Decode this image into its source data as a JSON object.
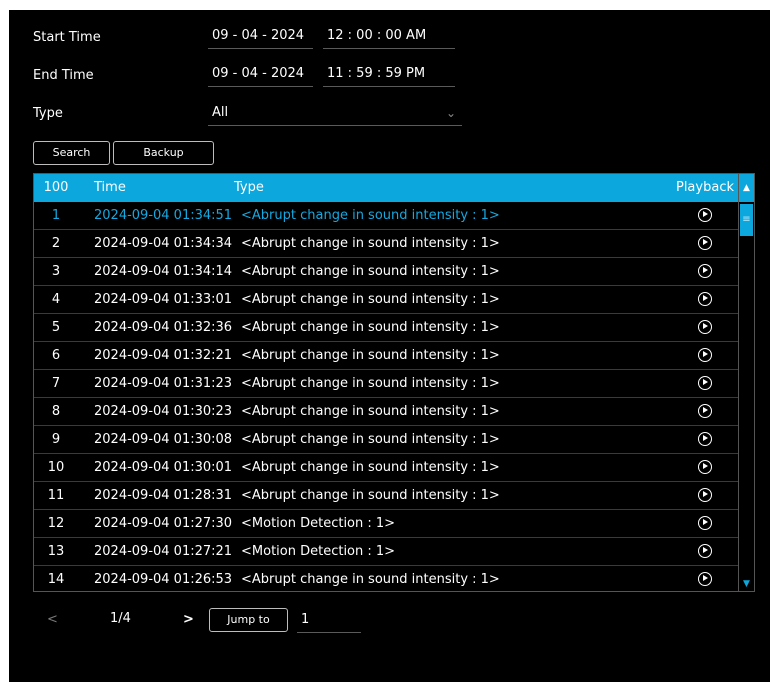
{
  "filters": {
    "start_label": "Start Time",
    "start_date": "09 - 04 - 2024",
    "start_time": "12 : 00 : 00  AM",
    "end_label": "End Time",
    "end_date": "09 - 04 - 2024",
    "end_time": "11 : 59 : 59  PM",
    "type_label": "Type",
    "type_value": "All"
  },
  "buttons": {
    "search": "Search",
    "backup": "Backup",
    "jump": "Jump to"
  },
  "table": {
    "headers": {
      "count": "100",
      "time": "Time",
      "type": "Type",
      "playback": "Playback"
    },
    "rows": [
      {
        "num": "1",
        "time": "2024-09-04 01:34:51",
        "type": "<Abrupt change in sound intensity : 1>"
      },
      {
        "num": "2",
        "time": "2024-09-04 01:34:34",
        "type": "<Abrupt change in sound intensity : 1>"
      },
      {
        "num": "3",
        "time": "2024-09-04 01:34:14",
        "type": "<Abrupt change in sound intensity : 1>"
      },
      {
        "num": "4",
        "time": "2024-09-04 01:33:01",
        "type": "<Abrupt change in sound intensity : 1>"
      },
      {
        "num": "5",
        "time": "2024-09-04 01:32:36",
        "type": "<Abrupt change in sound intensity : 1>"
      },
      {
        "num": "6",
        "time": "2024-09-04 01:32:21",
        "type": "<Abrupt change in sound intensity : 1>"
      },
      {
        "num": "7",
        "time": "2024-09-04 01:31:23",
        "type": "<Abrupt change in sound intensity : 1>"
      },
      {
        "num": "8",
        "time": "2024-09-04 01:30:23",
        "type": "<Abrupt change in sound intensity : 1>"
      },
      {
        "num": "9",
        "time": "2024-09-04 01:30:08",
        "type": "<Abrupt change in sound intensity : 1>"
      },
      {
        "num": "10",
        "time": "2024-09-04 01:30:01",
        "type": "<Abrupt change in sound intensity : 1>"
      },
      {
        "num": "11",
        "time": "2024-09-04 01:28:31",
        "type": "<Abrupt change in sound intensity : 1>"
      },
      {
        "num": "12",
        "time": "2024-09-04 01:27:30",
        "type": "<Motion Detection : 1>"
      },
      {
        "num": "13",
        "time": "2024-09-04 01:27:21",
        "type": "<Motion Detection : 1>"
      },
      {
        "num": "14",
        "time": "2024-09-04 01:26:53",
        "type": "<Abrupt change in sound intensity : 1>"
      }
    ],
    "selected_index": 0
  },
  "pager": {
    "prev": "<",
    "page": "1/4",
    "next": ">",
    "jump_value": "1"
  },
  "icons": {
    "play": "play-circle-icon",
    "dropdown": "chevron-down-icon",
    "scroll_up": "scroll-up-arrow-icon",
    "scroll_down": "scroll-down-arrow-icon"
  },
  "colors": {
    "accent": "#0ba7dd",
    "selected_text": "#16a8e0",
    "background": "#000000"
  }
}
